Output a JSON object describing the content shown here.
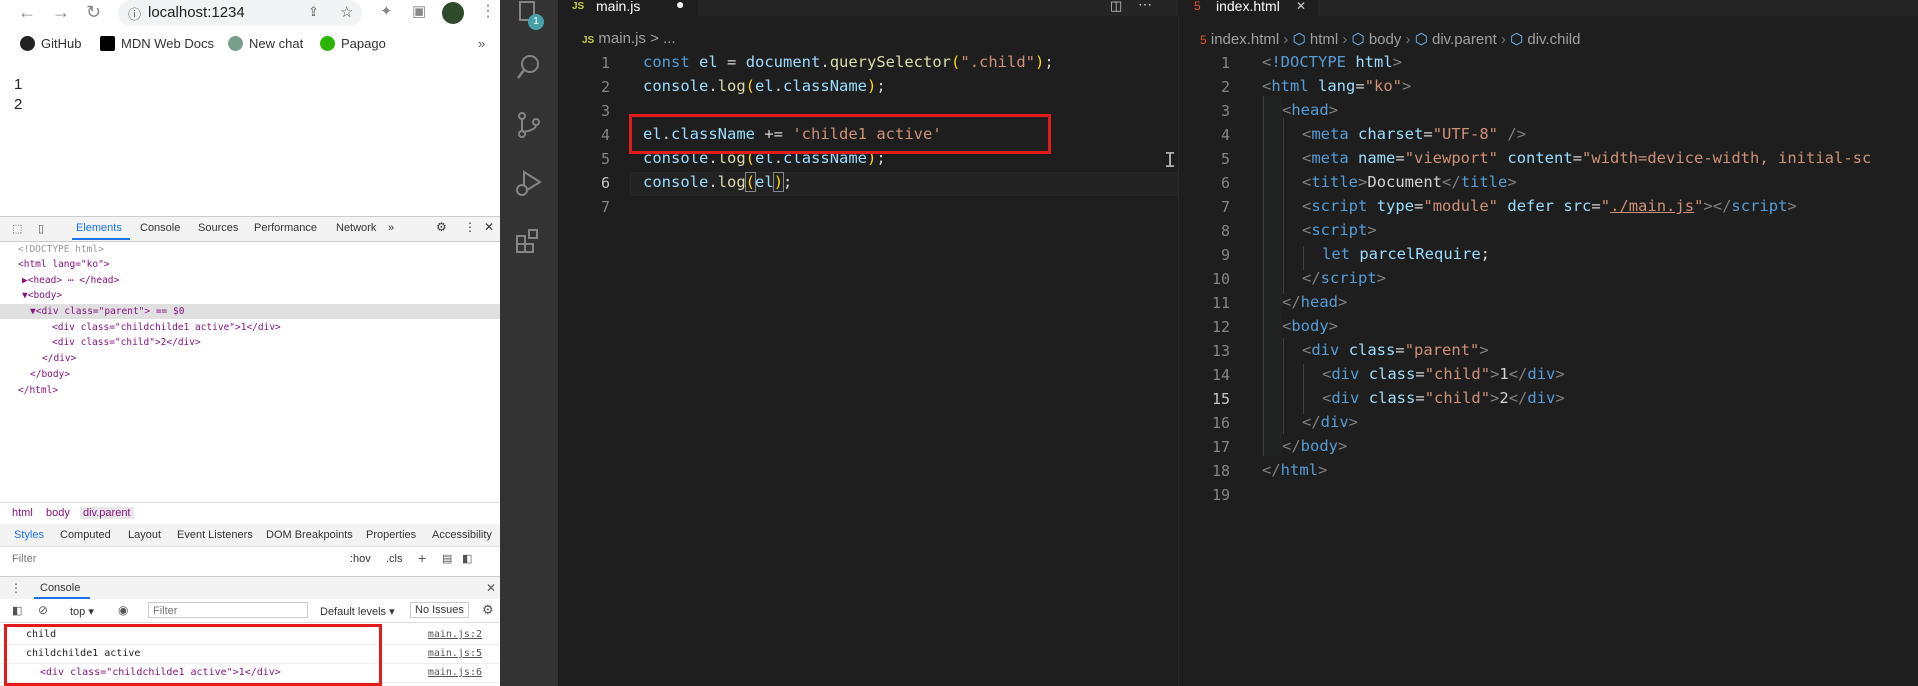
{
  "browser": {
    "url": "localhost:1234",
    "bookmarks": [
      "GitHub",
      "MDN Web Docs",
      "New chat",
      "Papago"
    ],
    "page_lines": [
      "1",
      "2"
    ],
    "devtools": {
      "tabs": [
        "Elements",
        "Console",
        "Sources",
        "Performance",
        "Network"
      ],
      "dom_lines": [
        "<!DOCTYPE html>",
        "<html lang=\"ko\">",
        "▶<head> ⋯ </head>",
        "▼<body>",
        "▼<div class=\"parent\"> == $0",
        "<div class=\"childchilde1 active\">1</div>",
        "<div class=\"child\">2</div>",
        "</div>",
        "</body>",
        "</html>"
      ],
      "breadcrumbs": [
        "html",
        "body",
        "div.parent"
      ],
      "subtabs": [
        "Styles",
        "Computed",
        "Layout",
        "Event Listeners",
        "DOM Breakpoints",
        "Properties",
        "Accessibility"
      ],
      "filter_placeholder": "Filter",
      "hov": ":hov",
      "cls": ".cls",
      "drawer_tab": "Console",
      "console_context": "top",
      "console_filter_placeholder": "Filter",
      "levels": "Default levels ▾",
      "no_issues": "No Issues",
      "console_lines": [
        {
          "text": "child",
          "source": "main.js:2"
        },
        {
          "text": "childchilde1 active",
          "source": "main.js:5"
        },
        {
          "text": "<div class=\"childchilde1 active\">1</div>",
          "source": "main.js:6"
        }
      ]
    }
  },
  "vscode": {
    "left_tab": "main.js",
    "left_breadcrumb": "main.js > ...",
    "badge": "1",
    "right_tab": "index.html",
    "right_breadcrumb": [
      "index.html",
      "html",
      "body",
      "div.parent",
      "div.child"
    ],
    "main_js_line_numbers": [
      "1",
      "2",
      "3",
      "4",
      "5",
      "6",
      "7"
    ],
    "index_line_numbers": [
      "1",
      "2",
      "3",
      "4",
      "5",
      "6",
      "7",
      "8",
      "9",
      "10",
      "11",
      "12",
      "13",
      "14",
      "15",
      "16",
      "17",
      "18",
      "19"
    ]
  },
  "colors": {
    "highlight_box": "#e31b1b",
    "editor_bg": "#1e1e1e"
  }
}
